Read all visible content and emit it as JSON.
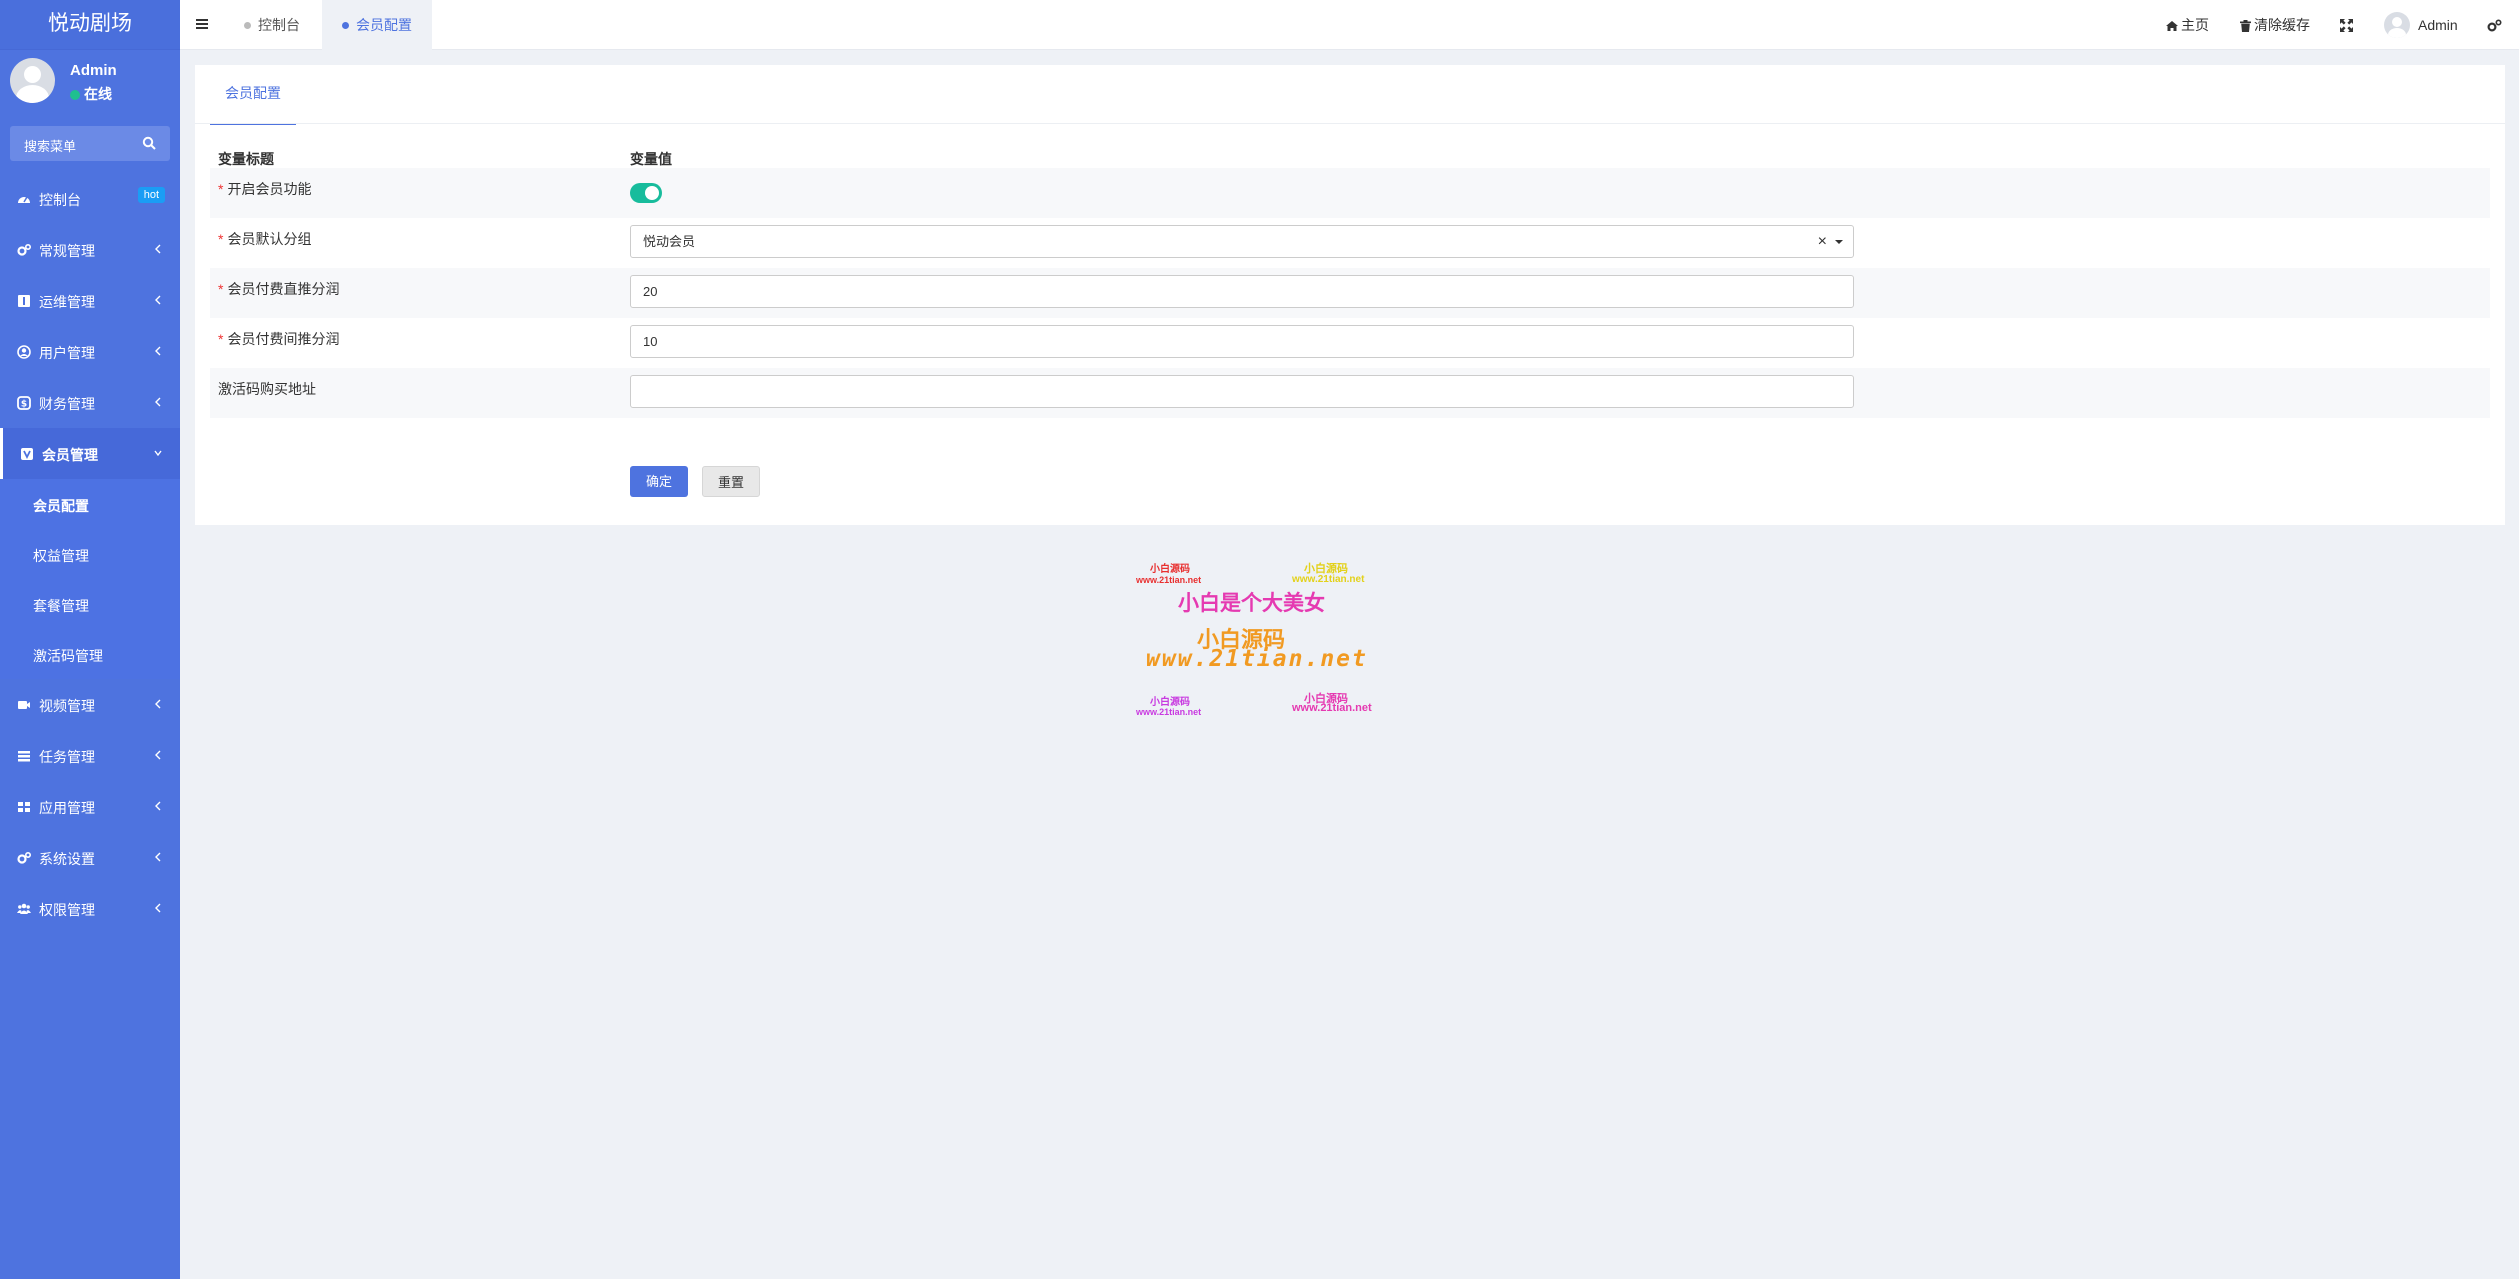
{
  "app": {
    "title": "悦动剧场"
  },
  "user": {
    "name": "Admin",
    "status": "在线"
  },
  "search": {
    "placeholder": "搜索菜单"
  },
  "sidebar": {
    "items": [
      {
        "label": "控制台",
        "icon": "dashboard-icon",
        "badge": "hot"
      },
      {
        "label": "常规管理",
        "icon": "cogs-icon"
      },
      {
        "label": "运维管理",
        "icon": "server-icon"
      },
      {
        "label": "用户管理",
        "icon": "user-circle-icon"
      },
      {
        "label": "财务管理",
        "icon": "money-icon"
      },
      {
        "label": "会员管理",
        "icon": "vip-icon",
        "active": true,
        "children": [
          {
            "label": "会员配置",
            "active": true
          },
          {
            "label": "权益管理"
          },
          {
            "label": "套餐管理"
          },
          {
            "label": "激活码管理"
          }
        ]
      },
      {
        "label": "视频管理",
        "icon": "video-icon"
      },
      {
        "label": "任务管理",
        "icon": "tasks-icon"
      },
      {
        "label": "应用管理",
        "icon": "apps-icon"
      },
      {
        "label": "系统设置",
        "icon": "cogs-icon"
      },
      {
        "label": "权限管理",
        "icon": "group-icon"
      }
    ]
  },
  "topbar": {
    "tabs": [
      {
        "label": "控制台"
      },
      {
        "label": "会员配置",
        "active": true
      }
    ],
    "home_label": "主页",
    "clear_cache_label": "清除缓存",
    "user_label": "Admin"
  },
  "panel": {
    "tab_label": "会员配置",
    "col_title": "变量标题",
    "col_value": "变量值",
    "rows": [
      {
        "label": "开启会员功能",
        "required": true,
        "type": "switch",
        "value": true
      },
      {
        "label": "会员默认分组",
        "required": true,
        "type": "select",
        "value": "悦动会员"
      },
      {
        "label": "会员付费直推分润",
        "required": true,
        "type": "input",
        "value": "20"
      },
      {
        "label": "会员付费间推分润",
        "required": true,
        "type": "input",
        "value": "10"
      },
      {
        "label": "激活码购买地址",
        "required": false,
        "type": "input",
        "value": ""
      }
    ],
    "submit_label": "确定",
    "reset_label": "重置"
  },
  "watermark": {
    "line1": "小白源码",
    "line1_url": "www.21tian.net",
    "line2": "小白源码",
    "line2_url": "www.21tian.net",
    "slogan": "小白是个大美女",
    "brand": "小白源码",
    "site": "www.21tian.net",
    "line3": "小白源码",
    "line3_url": "www.21tian.net",
    "line4": "小白源码",
    "line4_url": "www.21tian.net"
  },
  "colors": {
    "primary": "#4e73df",
    "success": "#18bc9c",
    "danger": "#e33333",
    "badge": "#1a9df5"
  }
}
